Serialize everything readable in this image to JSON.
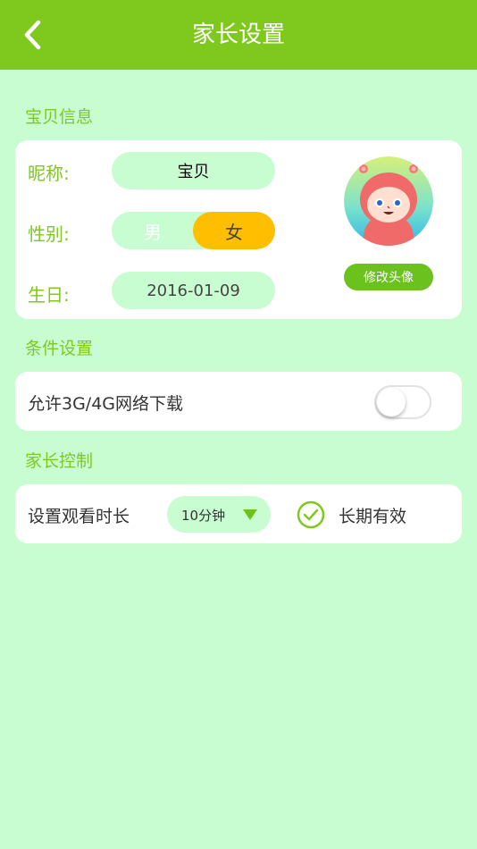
{
  "header": {
    "title": "家长设置",
    "back_icon": "chevron-left-icon"
  },
  "sections": {
    "baby_info": "宝贝信息",
    "conditions": "条件设置",
    "parent_control": "家长控制"
  },
  "baby_info": {
    "nickname_label": "昵称:",
    "nickname_value": "宝贝",
    "gender_label": "性别:",
    "gender_male": "男",
    "gender_female": "女",
    "gender_selected": "女",
    "birthday_label": "生日:",
    "birthday_value": "2016-01-09",
    "change_avatar_label": "修改头像"
  },
  "conditions": {
    "network_download_label": "允许3G/4G网络下载",
    "network_download_enabled": false
  },
  "parent_control": {
    "watch_duration_label": "设置观看时长",
    "duration_value": "10分钟",
    "long_term_label": "长期有效",
    "long_term_checked": true
  },
  "colors": {
    "accent": "#7fc91f",
    "background": "#c8fdd2",
    "selected_gender": "#ffbe00"
  }
}
